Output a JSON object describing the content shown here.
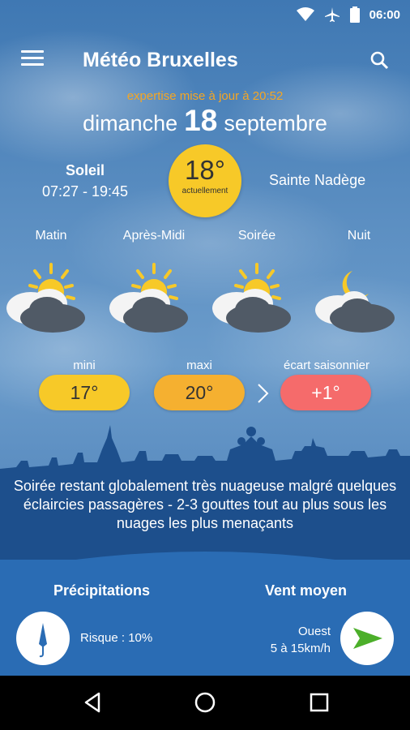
{
  "status": {
    "time": "06:00"
  },
  "app": {
    "title": "Météo Bruxelles"
  },
  "update": {
    "text": "expertise mise à jour à 20:52"
  },
  "date": {
    "weekday": "dimanche",
    "day": "18",
    "month": "septembre"
  },
  "sun": {
    "label": "Soleil",
    "times": "07:27 - 19:45"
  },
  "current": {
    "temp": "18°",
    "label": "actuellement"
  },
  "saint": "Sainte Nadège",
  "periods": [
    {
      "label": "Matin",
      "icon": "partly-cloudy-rain-icon"
    },
    {
      "label": "Après-Midi",
      "icon": "partly-cloudy-rain-icon"
    },
    {
      "label": "Soirée",
      "icon": "partly-cloudy-rain-icon"
    },
    {
      "label": "Nuit",
      "icon": "night-cloudy-icon"
    }
  ],
  "temps": {
    "min_label": "mini",
    "min_value": "17°",
    "max_label": "maxi",
    "max_value": "20°",
    "gap_label": "écart saisonnier",
    "gap_value": "+1°"
  },
  "description": "Soirée restant globalement très nuageuse malgré quelques éclaircies passagères - 2-3 gouttes tout au plus sous les nuages les plus menaçants",
  "precip": {
    "title": "Précipitations",
    "risk": "Risque : 10%"
  },
  "wind": {
    "title": "Vent moyen",
    "direction": "Ouest",
    "speed": "5 à 15km/h"
  },
  "colors": {
    "min": "#f7c928",
    "max": "#f5b030",
    "gap": "#f56b6b",
    "update": "#f5a623",
    "wind_arrow": "#4caf2a"
  }
}
